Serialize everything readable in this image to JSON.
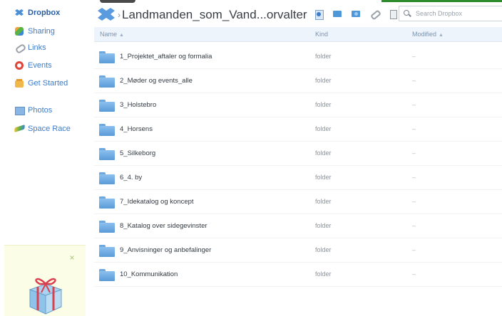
{
  "sidebar": {
    "items": [
      {
        "label": "Dropbox",
        "icon": "dropbox-icon"
      },
      {
        "label": "Sharing",
        "icon": "sharing-icon"
      },
      {
        "label": "Links",
        "icon": "links-icon"
      },
      {
        "label": "Events",
        "icon": "events-icon"
      },
      {
        "label": "Get Started",
        "icon": "get-started-icon"
      },
      {
        "label": "Photos",
        "icon": "photos-icon"
      },
      {
        "label": "Space Race",
        "icon": "space-race-icon"
      }
    ],
    "promo_close": "×"
  },
  "header": {
    "separator": "›",
    "folder_title": "Landmanden_som_Vand...orvalter"
  },
  "search": {
    "placeholder": "Search Dropbox"
  },
  "table": {
    "columns": {
      "name": "Name",
      "name_sort": "▲",
      "kind": "Kind",
      "modified": "Modified",
      "modified_sort": "▲"
    },
    "rows": [
      {
        "name": "1_Projektet_aftaler og formalia",
        "kind": "folder",
        "modified": "–"
      },
      {
        "name": "2_Møder og events_alle",
        "kind": "folder",
        "modified": "–"
      },
      {
        "name": "3_Holstebro",
        "kind": "folder",
        "modified": "–"
      },
      {
        "name": "4_Horsens",
        "kind": "folder",
        "modified": "–"
      },
      {
        "name": "5_Silkeborg",
        "kind": "folder",
        "modified": "–"
      },
      {
        "name": "6_4. by",
        "kind": "folder",
        "modified": "–"
      },
      {
        "name": "7_Idekatalog og koncept",
        "kind": "folder",
        "modified": "–"
      },
      {
        "name": "8_Katalog over sidegevinster",
        "kind": "folder",
        "modified": "–"
      },
      {
        "name": "9_Anvisninger og anbefalinger",
        "kind": "folder",
        "modified": "–"
      },
      {
        "name": "10_Kommunikation",
        "kind": "folder",
        "modified": "–"
      }
    ]
  },
  "colors": {
    "link": "#3d7cc9",
    "header_bg": "#eef4fb",
    "folder": "#5a9ad8",
    "promo_bg": "#fbfde7"
  }
}
